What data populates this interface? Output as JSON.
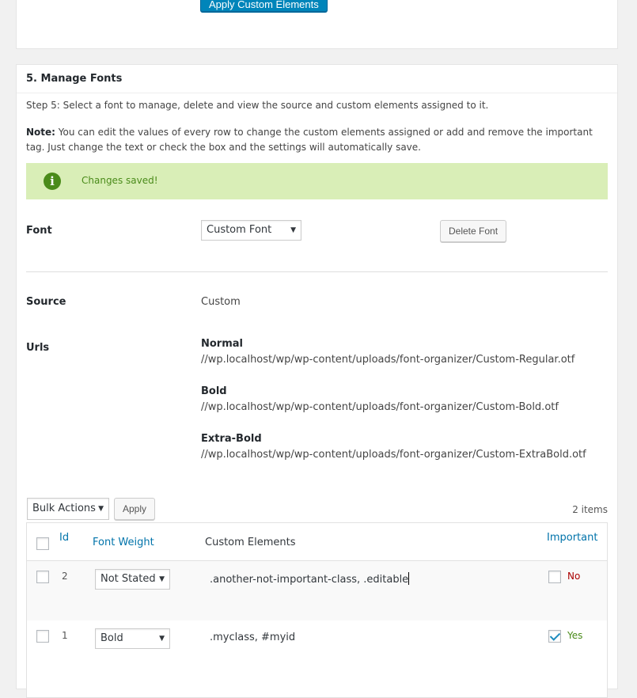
{
  "top_panel": {
    "apply_button": "Apply Custom Elements"
  },
  "manage": {
    "header": "5. Manage Fonts",
    "step": "Step 5: Select a font to manage, delete and view the source and custom elements assigned to it.",
    "note_label": "Note:",
    "note_text": " You can edit the values of every row to change the custom elements assigned or add and remove the important tag. Just change the text or check the box and the settings will automatically save.",
    "notice": {
      "icon": "info-icon",
      "text": "Changes saved!",
      "color": "#4a8b1a",
      "bg": "#d9eeb7"
    },
    "font_label": "Font",
    "font_select": "Custom Font",
    "delete_button": "Delete Font",
    "source_label": "Source",
    "source_value": "Custom",
    "urls_label": "Urls",
    "urls": [
      {
        "title": "Normal",
        "url": "//wp.localhost/wp/wp-content/uploads/font-organizer/Custom-Regular.otf"
      },
      {
        "title": "Bold",
        "url": "//wp.localhost/wp/wp-content/uploads/font-organizer/Custom-Bold.otf"
      },
      {
        "title": "Extra-Bold",
        "url": "//wp.localhost/wp/wp-content/uploads/font-organizer/Custom-ExtraBold.otf"
      }
    ]
  },
  "table": {
    "bulk_actions": "Bulk Actions",
    "apply": "Apply",
    "items_count": "2 items",
    "columns": {
      "id": "Id",
      "font_weight": "Font Weight",
      "custom_elements": "Custom Elements",
      "important": "Important"
    },
    "rows": [
      {
        "id": "2",
        "weight": "Not Stated",
        "elements": ".another-not-important-class, .editable",
        "important_checked": false,
        "important_label": "No"
      },
      {
        "id": "1",
        "weight": "Bold",
        "elements": ".myclass, #myid",
        "important_checked": true,
        "important_label": "Yes"
      }
    ]
  }
}
